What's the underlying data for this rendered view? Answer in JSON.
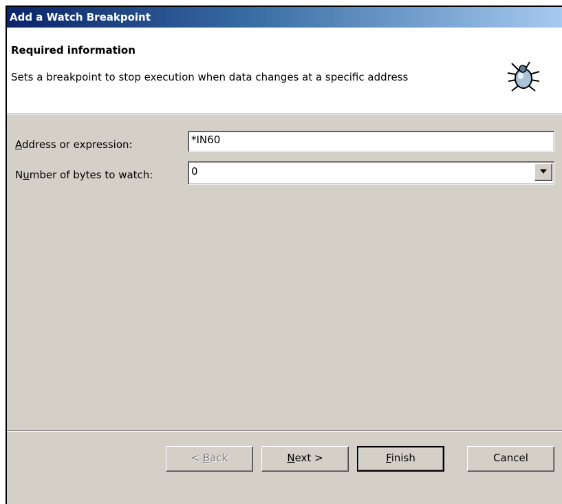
{
  "window": {
    "title": "Add a Watch Breakpoint"
  },
  "header": {
    "title": "Required information",
    "description": "Sets a breakpoint to stop execution when data changes at a specific address",
    "icon": "bug-icon"
  },
  "form": {
    "address": {
      "label_mnemonic": "A",
      "label_rest": "ddress or expression:",
      "value": "*IN60"
    },
    "bytes": {
      "label_pre": "N",
      "label_mnemonic": "u",
      "label_rest": "mber of bytes to watch:",
      "value": "0"
    }
  },
  "buttons": {
    "back": {
      "pre": "< ",
      "mnemonic": "B",
      "rest": "ack"
    },
    "next": {
      "mnemonic": "N",
      "rest": "ext >"
    },
    "finish": {
      "mnemonic": "F",
      "rest": "inish"
    },
    "cancel": {
      "label": "Cancel"
    }
  }
}
